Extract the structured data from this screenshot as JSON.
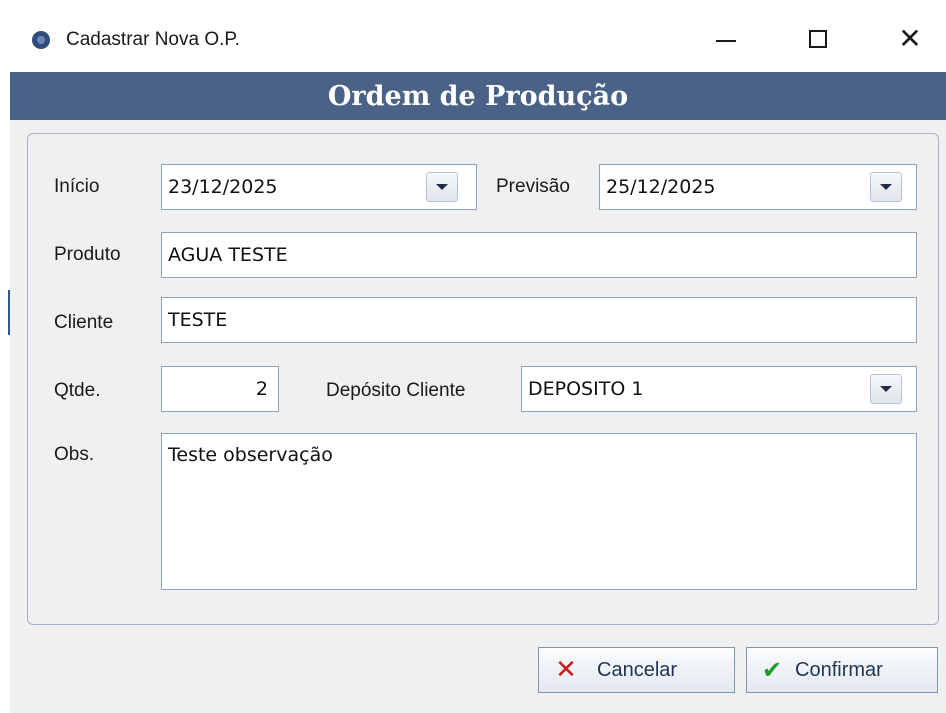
{
  "window": {
    "title": "Cadastrar Nova O.P.",
    "controls": {
      "minimize": "minimize-icon",
      "maximize": "maximize-icon",
      "close": "close-icon"
    }
  },
  "header": {
    "title": "Ordem de Produção"
  },
  "form": {
    "inicio": {
      "label": "Início",
      "value": "23/12/2025"
    },
    "previsao": {
      "label": "Previsão",
      "value": "25/12/2025"
    },
    "produto": {
      "label": "Produto",
      "value": "AGUA TESTE"
    },
    "cliente": {
      "label": "Cliente",
      "value": "TESTE"
    },
    "qtde": {
      "label": "Qtde.",
      "value": "2"
    },
    "deposito_cliente": {
      "label": "Depósito Cliente",
      "value": "DEPOSITO 1"
    },
    "obs": {
      "label": "Obs.",
      "value": "Teste observação"
    }
  },
  "buttons": {
    "cancel": {
      "label": "Cancelar",
      "icon": "x-icon",
      "color": "#d11a1a"
    },
    "confirm": {
      "label": "Confirmar",
      "icon": "check-icon",
      "color": "#1f9b2a"
    }
  },
  "colors": {
    "header_bg": "#4a6286",
    "panel_border": "#a6b4c6"
  }
}
